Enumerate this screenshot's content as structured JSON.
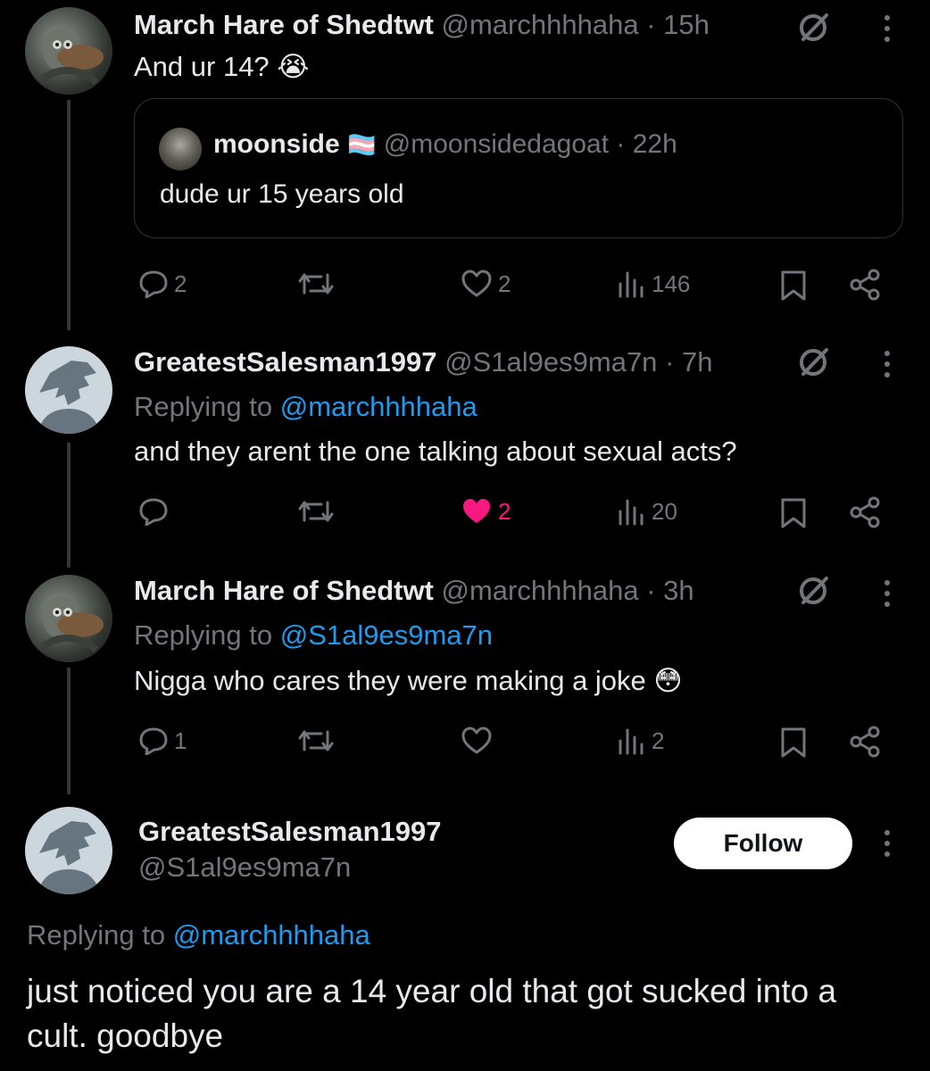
{
  "tweets": [
    {
      "name": "March Hare of Shedtwt",
      "handle": "@marchhhhaha",
      "time": "· 15h",
      "text": "And ur 14? 😭",
      "quote": {
        "name": "moonside",
        "flag": "🏳️‍⚧️",
        "handle": "@moonsidedagoat",
        "time": "· 22h",
        "text": "dude ur 15 years old"
      },
      "replies": "2",
      "likes": "2",
      "views": "146"
    },
    {
      "name": "GreatestSalesman1997",
      "handle": "@S1al9es9ma7n",
      "time": "· 7h",
      "replying_prefix": "Replying to ",
      "replying_to": "@marchhhhaha",
      "text": "and they arent the one talking about sexual acts?",
      "replies": "",
      "likes": "2",
      "views": "20"
    },
    {
      "name": "March Hare of Shedtwt",
      "handle": "@marchhhhaha",
      "time": "· 3h",
      "replying_prefix": "Replying to ",
      "replying_to": "@S1al9es9ma7n",
      "text": "Nigga who cares they were making a joke 😳",
      "replies": "1",
      "likes": "",
      "views": "2"
    }
  ],
  "main": {
    "name": "GreatestSalesman1997",
    "handle": "@S1al9es9ma7n",
    "follow_label": "Follow",
    "replying_prefix": "Replying to ",
    "replying_to": "@marchhhhaha",
    "text_line1": "just noticed you are a 14 year old that got sucked into a",
    "text_line2": "cult. goodbye"
  },
  "colors": {
    "background": "#000000",
    "text": "#e7e9ea",
    "muted": "#71767b",
    "link": "#1d9bf0",
    "liked": "#f91880"
  }
}
